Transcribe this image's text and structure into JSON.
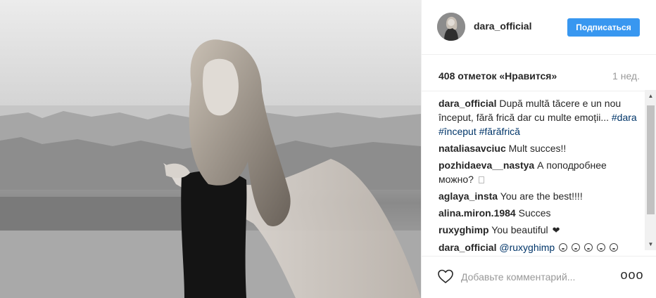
{
  "post": {
    "username": "dara_official",
    "follow_label": "Подписаться",
    "likes_text": "408 отметок «Нравится»",
    "time_text": "1 нед.",
    "comment_placeholder": "Добавьте комментарий...",
    "more_label": "ooo"
  },
  "comments": [
    {
      "author": "dara_official",
      "text": "După multă tăcere e un nou început, fără frică dar cu multe emoții... ",
      "tags": [
        "#dara",
        "#început",
        "#fărăfrică"
      ]
    },
    {
      "author": "nataliasavciuc",
      "text": "Mult succes!!"
    },
    {
      "author": "pozhidaeva__nastya",
      "text": "А поподробнее можно?"
    },
    {
      "author": "aglaya_insta",
      "text": "You are the best!!!!"
    },
    {
      "author": "alina.miron.1984",
      "text": "Succes"
    },
    {
      "author": "ruxyghimp",
      "text": "You beautiful"
    },
    {
      "author": "dara_official",
      "text": "",
      "mention": "@ruxyghimp"
    }
  ],
  "icons": {
    "heart": "heart-outline-icon",
    "more": "ellipsis-icon",
    "scroll_up": "scroll-up-arrow",
    "scroll_down": "scroll-down-arrow"
  },
  "colors": {
    "follow_button": "#3897f0",
    "link": "#003569",
    "muted": "#999999",
    "text": "#262626"
  }
}
